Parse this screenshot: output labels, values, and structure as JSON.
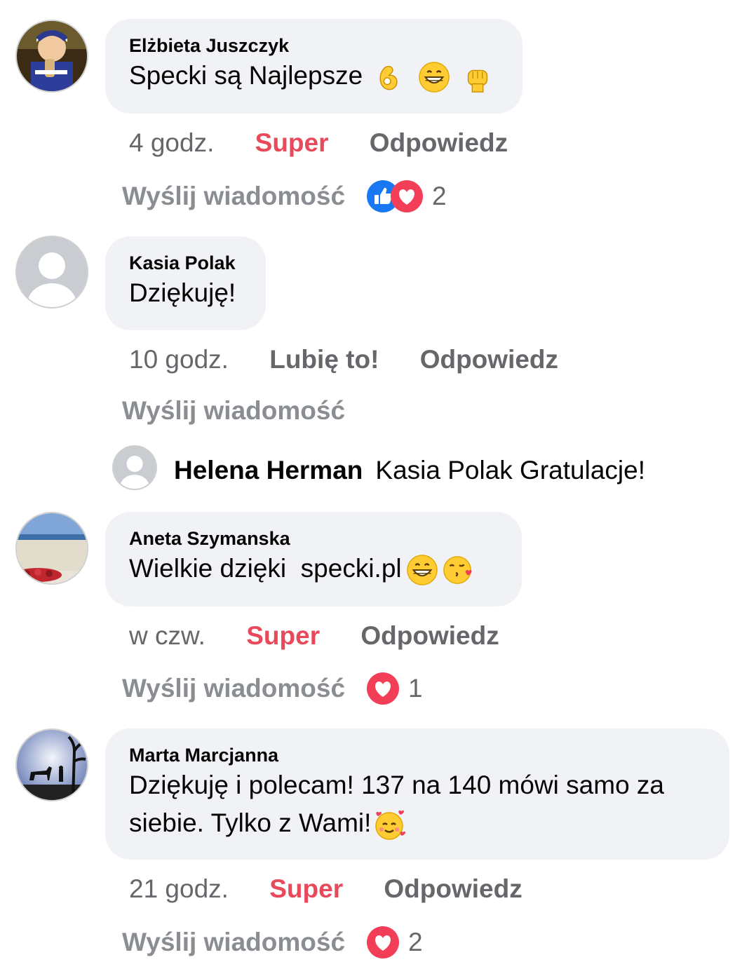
{
  "comments": [
    {
      "author": "Elżbieta Juszczyk",
      "text": "Specki są Najlepsze",
      "time": "4 godz.",
      "reaction_label": "Super",
      "reply_label": "Odpowiedz",
      "message_label": "Wyślij wiadomość",
      "reaction_count": "2",
      "reaction_icons": [
        "like-icon",
        "love-icon"
      ],
      "emojis": [
        "ok-hand-emoji",
        "grinning-emoji",
        "fist-emoji"
      ]
    },
    {
      "author": "Kasia Polak",
      "text": "Dziękuję!",
      "time": "10 godz.",
      "reaction_label": "Lubię to!",
      "reply_label": "Odpowiedz",
      "message_label": "Wyślij wiadomość"
    },
    {
      "author": "Aneta Szymanska",
      "text": "Wielkie dzięki  specki.pl",
      "time": "w czw.",
      "reaction_label": "Super",
      "reply_label": "Odpowiedz",
      "message_label": "Wyślij wiadomość",
      "reaction_count": "1",
      "reaction_icons": [
        "love-icon"
      ],
      "emojis": [
        "grinning-emoji",
        "kissing-emoji"
      ]
    },
    {
      "author": "Marta Marcjanna",
      "text_line1": "Dziękuję i polecam! 137 na 140 mówi samo za",
      "text_line2": "siebie. Tylko z Wami!",
      "time": "21 godz.",
      "reaction_label": "Super",
      "reply_label": "Odpowiedz",
      "message_label": "Wyślij wiadomość",
      "reaction_count": "2",
      "reaction_icons": [
        "love-icon"
      ],
      "emojis": [
        "smiling-hearts-emoji"
      ]
    }
  ],
  "reply": {
    "author": "Helena Herman",
    "text": "Kasia Polak Gratulacje!"
  },
  "colors": {
    "bubble": "#f0f2f5",
    "super": "#e94a5b",
    "like_blue": "#1877f2",
    "love_red": "#f33e58",
    "muted": "#65676b"
  }
}
